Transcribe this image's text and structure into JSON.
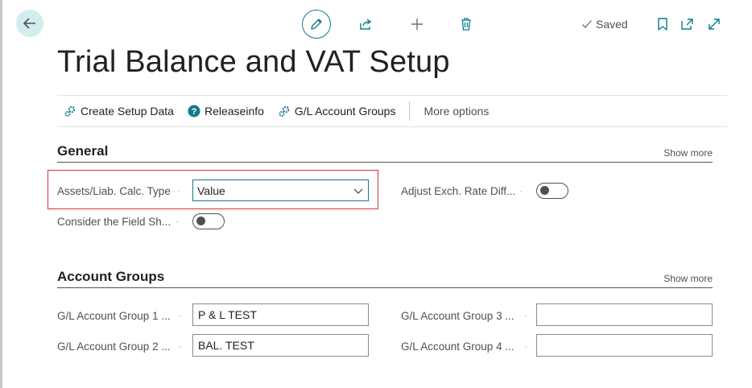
{
  "header": {
    "saved_label": "Saved"
  },
  "page": {
    "title": "Trial Balance and VAT Setup"
  },
  "actions": {
    "create_setup_data": "Create Setup Data",
    "releaseinfo": "Releaseinfo",
    "gl_account_groups": "G/L Account Groups",
    "more_options": "More options"
  },
  "general": {
    "title": "General",
    "show_more": "Show more",
    "assets_calc_type_label": "Assets/Liab. Calc. Type",
    "assets_calc_type_value": "Value",
    "consider_field_label": "Consider the Field Sh...",
    "consider_field_on": false,
    "adjust_exch_label": "Adjust Exch. Rate Diff...",
    "adjust_exch_on": false
  },
  "account_groups": {
    "title": "Account Groups",
    "show_more": "Show more",
    "group1_label": "G/L Account Group 1 ...",
    "group1_value": "P & L TEST",
    "group2_label": "G/L Account Group 2 ...",
    "group2_value": "BAL. TEST",
    "group3_label": "G/L Account Group 3 ...",
    "group3_value": "",
    "group4_label": "G/L Account Group 4 ...",
    "group4_value": ""
  },
  "colors": {
    "accent": "#0f7b8a",
    "highlight": "#d13438"
  }
}
